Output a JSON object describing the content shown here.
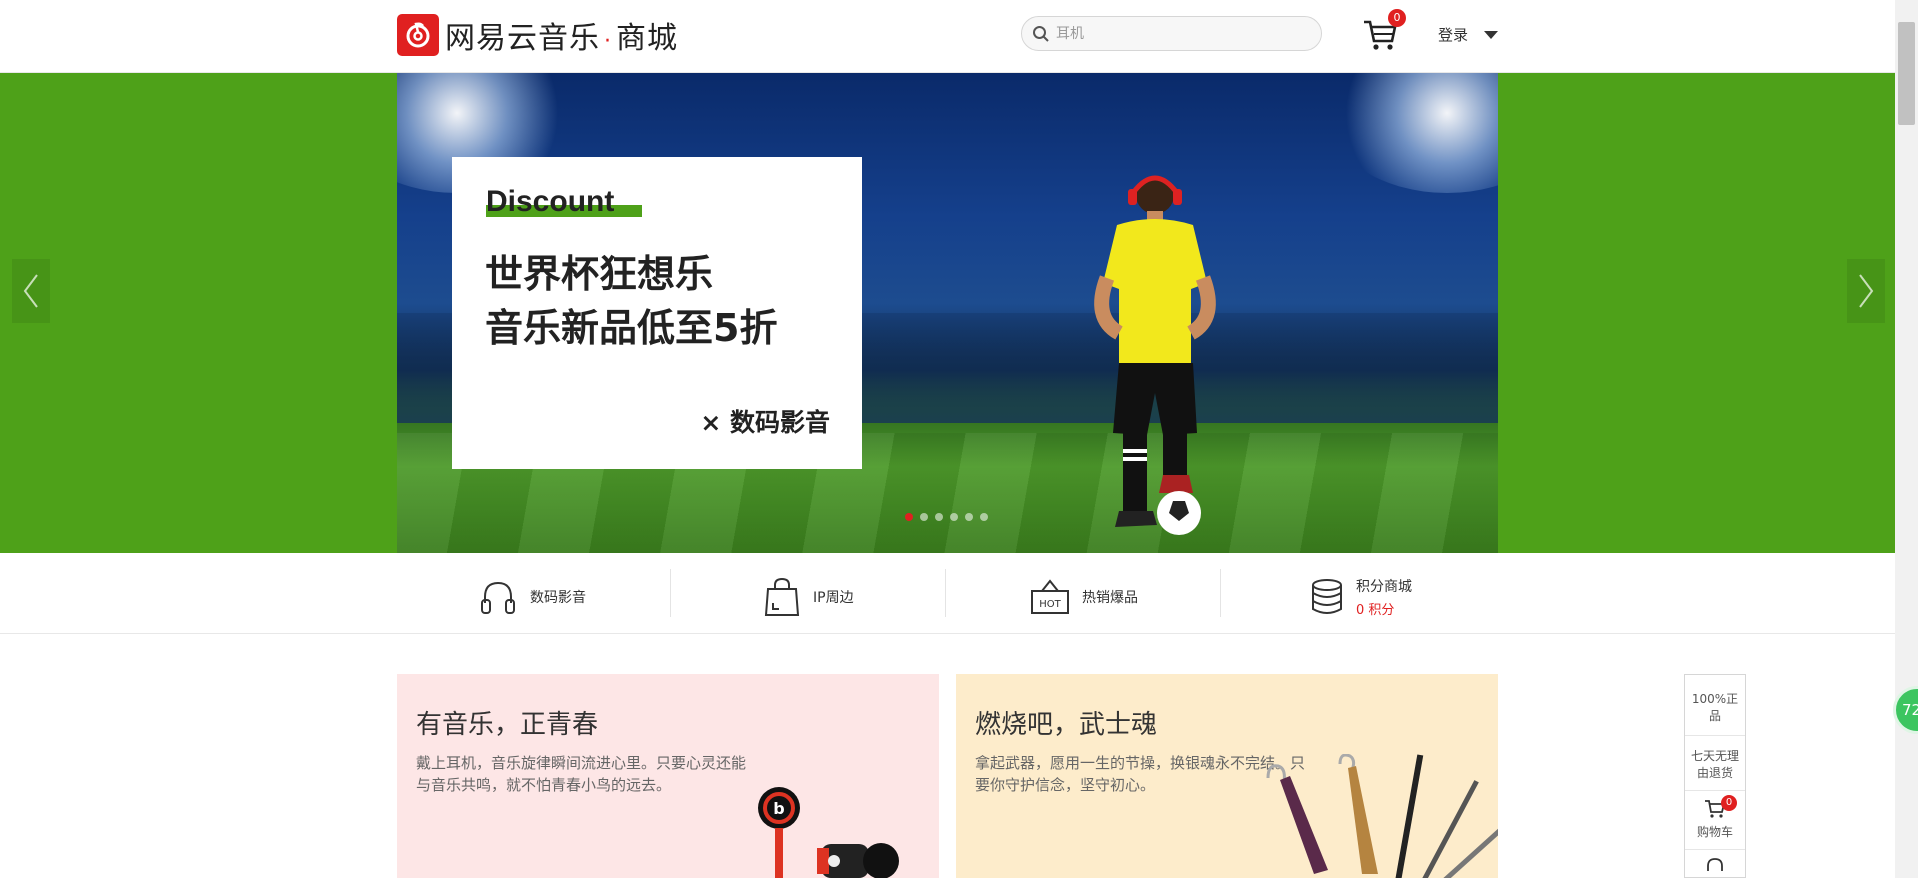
{
  "header": {
    "logo_text": "网易云音乐",
    "logo_dot": "·",
    "logo_sub": "商城",
    "search_placeholder": "耳机",
    "cart_count": "0",
    "login_label": "登录"
  },
  "banner": {
    "kicker": "Discount",
    "line1": "世界杯狂想乐",
    "line2": "音乐新品低至5折",
    "tag": "× 数码影音",
    "dots": 6,
    "active_dot": 0,
    "bg_color": "#4ea119"
  },
  "categories": [
    {
      "icon": "headphones-icon",
      "label": "数码影音"
    },
    {
      "icon": "shopping-bag-icon",
      "label": "IP周边"
    },
    {
      "icon": "hot-sign-icon",
      "label": "热销爆品"
    },
    {
      "icon": "database-icon",
      "label": "积分商城",
      "points": "0 积分"
    }
  ],
  "cards": [
    {
      "title": "有音乐，正青春",
      "desc": "戴上耳机，音乐旋律瞬间流进心里。只要心灵还能与音乐共鸣，就不怕青春小鸟的远去。",
      "bg": "#fde6e6"
    },
    {
      "title": "燃烧吧，武士魂",
      "desc": "拿起武器，愿用一生的节操，换银魂永不完结。只要你守护信念，坚守初心。",
      "bg": "#fdeccb"
    }
  ],
  "sidefloat": {
    "item1": "100%正品",
    "item2": "七天无理由退货",
    "cart_label": "购物车",
    "cart_count": "0",
    "bubble": "72"
  },
  "accent": "#e02020"
}
